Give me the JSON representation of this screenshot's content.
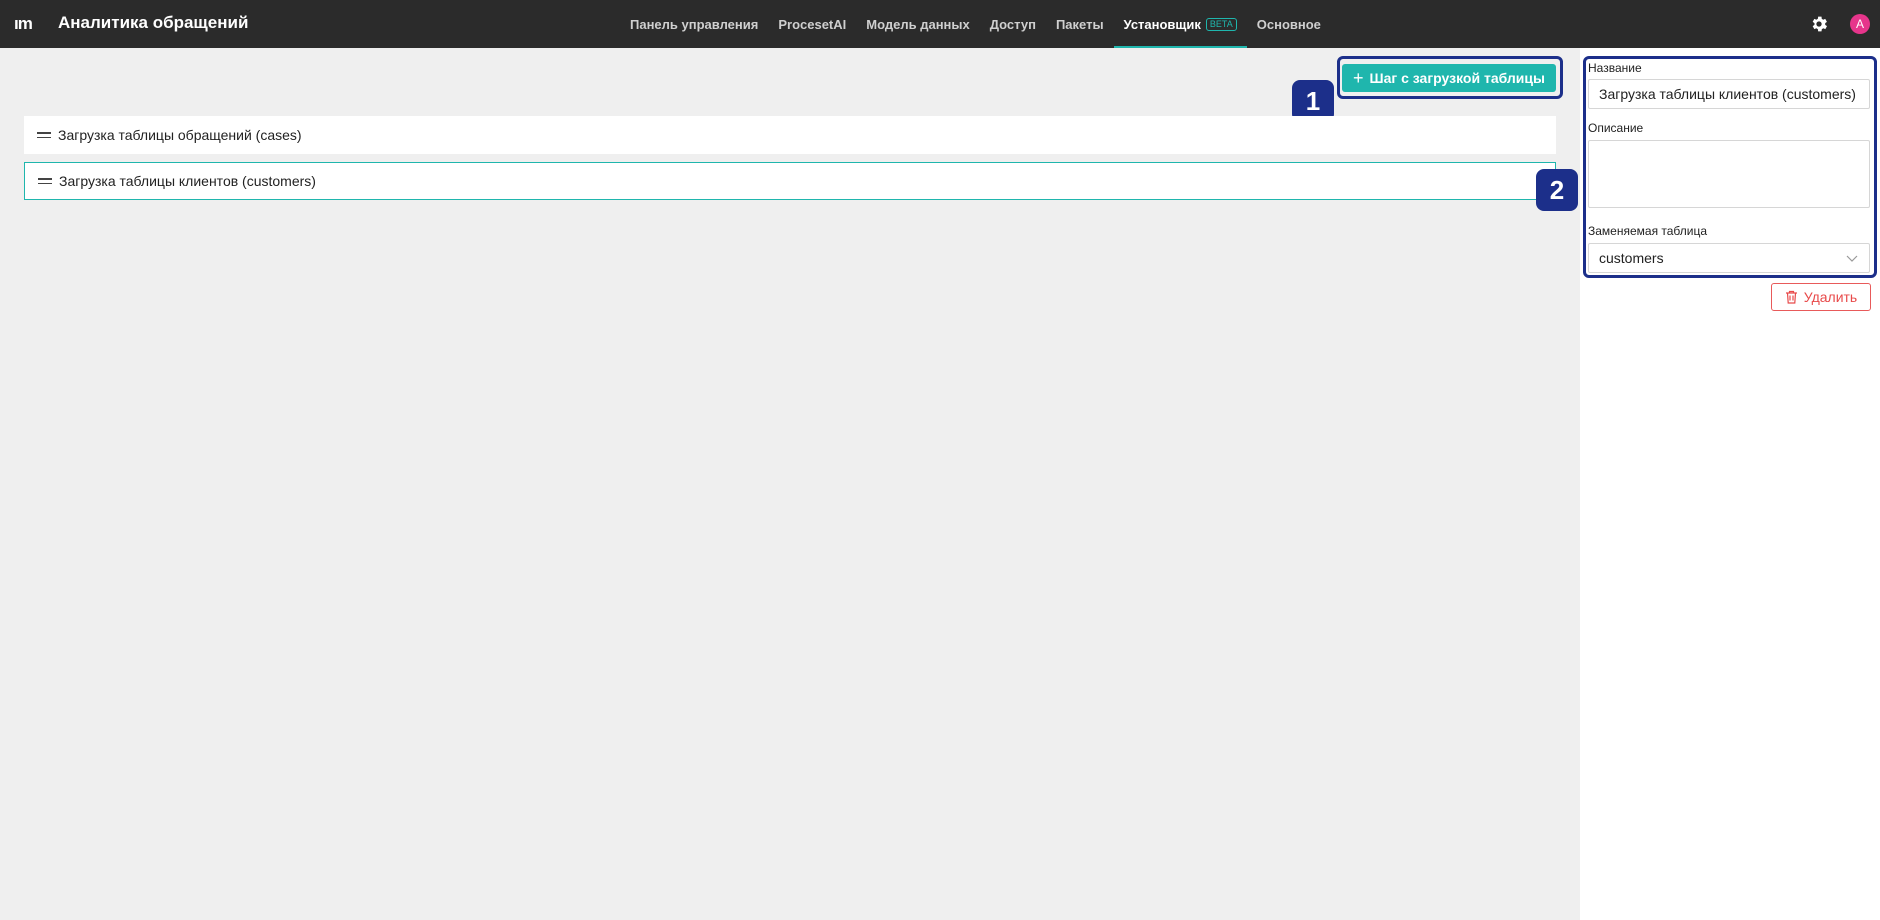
{
  "app": {
    "logo": "ım",
    "title": "Аналитика обращений"
  },
  "nav": {
    "items": [
      {
        "label": "Панель управления"
      },
      {
        "label": "ProcesetAI"
      },
      {
        "label": "Модель данных"
      },
      {
        "label": "Доступ"
      },
      {
        "label": "Пакеты"
      },
      {
        "label": "Установщик",
        "badge": "BETA",
        "active": true
      },
      {
        "label": "Основное"
      }
    ]
  },
  "user": {
    "avatar_initial": "A"
  },
  "toolbar": {
    "add_step_label": "Шаг с загрузкой таблицы"
  },
  "steps": [
    {
      "label": "Загрузка таблицы обращений (cases)"
    },
    {
      "label": "Загрузка таблицы клиентов (customers)",
      "selected": true
    }
  ],
  "markers": [
    "1",
    "2"
  ],
  "details": {
    "name_label": "Название",
    "name_value": "Загрузка таблицы клиентов (customers)",
    "description_label": "Описание",
    "description_value": "",
    "table_label": "Заменяемая таблица",
    "table_value": "customers",
    "delete_label": "Удалить"
  },
  "colors": {
    "accent": "#1fb6ad",
    "topbar": "#2b2b2b",
    "highlight": "#1c2f8a",
    "danger": "#e84a4a",
    "avatar": "#e6358b"
  }
}
